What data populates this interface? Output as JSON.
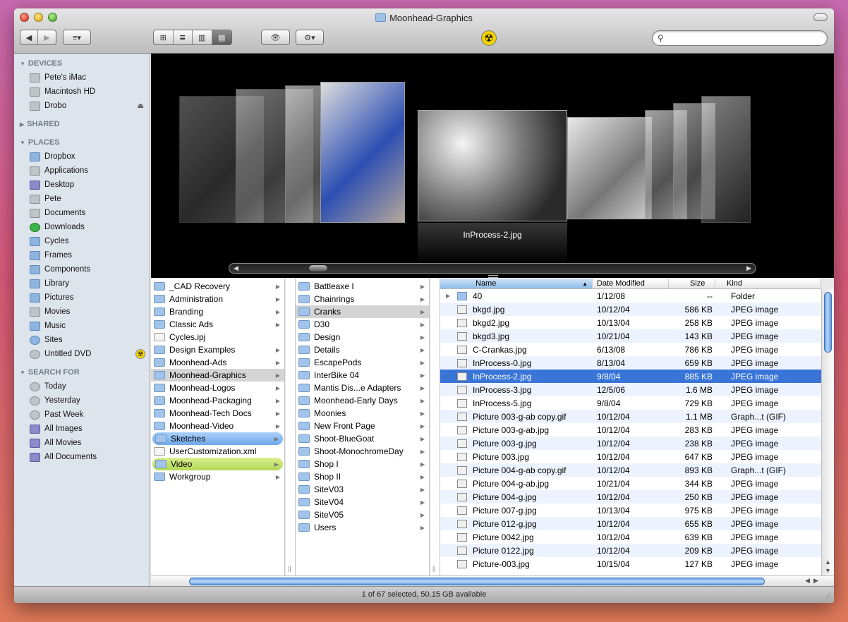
{
  "window": {
    "title": "Moonhead-Graphics"
  },
  "toolbar": {
    "back_icon": "◀",
    "forward_icon": "▶",
    "arrange_icon": "≡▾",
    "view_icons": [
      "⊞",
      "≣",
      "▥",
      "▤"
    ],
    "quicklook_icon": "👁",
    "action_icon": "⚙▾",
    "badge_icon": "☢",
    "search_placeholder": ""
  },
  "sidebar": {
    "sections": [
      {
        "title": "DEVICES",
        "items": [
          {
            "label": "Pete's iMac",
            "icon": "imac-icon"
          },
          {
            "label": "Macintosh HD",
            "icon": "disk-icon"
          },
          {
            "label": "Drobo",
            "icon": "drobo-icon",
            "eject": "⏏"
          }
        ]
      },
      {
        "title": "SHARED",
        "collapsed": true,
        "items": []
      },
      {
        "title": "PLACES",
        "items": [
          {
            "label": "Dropbox",
            "icon": "dropbox-icon"
          },
          {
            "label": "Applications",
            "icon": "applications-icon"
          },
          {
            "label": "Desktop",
            "icon": "desktop-icon"
          },
          {
            "label": "Pete",
            "icon": "home-icon"
          },
          {
            "label": "Documents",
            "icon": "documents-icon"
          },
          {
            "label": "Downloads",
            "icon": "downloads-icon"
          },
          {
            "label": "Cycles",
            "icon": "folder-icon"
          },
          {
            "label": "Frames",
            "icon": "folder-icon"
          },
          {
            "label": "Components",
            "icon": "folder-icon"
          },
          {
            "label": "Library",
            "icon": "folder-icon"
          },
          {
            "label": "Pictures",
            "icon": "pictures-icon"
          },
          {
            "label": "Movies",
            "icon": "movies-icon"
          },
          {
            "label": "Music",
            "icon": "music-icon"
          },
          {
            "label": "Sites",
            "icon": "sites-icon"
          },
          {
            "label": "Untitled DVD",
            "icon": "dvd-icon",
            "badge": "☢"
          }
        ]
      },
      {
        "title": "SEARCH FOR",
        "items": [
          {
            "label": "Today",
            "icon": "clock-icon"
          },
          {
            "label": "Yesterday",
            "icon": "clock-icon"
          },
          {
            "label": "Past Week",
            "icon": "clock-icon"
          },
          {
            "label": "All Images",
            "icon": "smart-folder-icon"
          },
          {
            "label": "All Movies",
            "icon": "smart-folder-icon"
          },
          {
            "label": "All Documents",
            "icon": "smart-folder-icon"
          }
        ]
      }
    ]
  },
  "coverflow": {
    "caption": "InProcess-2.jpg"
  },
  "column1": [
    {
      "label": "_CAD Recovery",
      "arrow": "▶"
    },
    {
      "label": "Administration",
      "arrow": "▶"
    },
    {
      "label": "Branding",
      "arrow": "▶"
    },
    {
      "label": "Classic Ads",
      "arrow": "▶"
    },
    {
      "label": "Cycles.ipj",
      "doc": true
    },
    {
      "label": "Design Examples",
      "arrow": "▶"
    },
    {
      "label": "Moonhead-Ads",
      "arrow": "▶"
    },
    {
      "label": "Moonhead-Graphics",
      "arrow": "▶",
      "state": "sel-gray"
    },
    {
      "label": "Moonhead-Logos",
      "arrow": "▶"
    },
    {
      "label": "Moonhead-Packaging",
      "arrow": "▶"
    },
    {
      "label": "Moonhead-Tech Docs",
      "arrow": "▶"
    },
    {
      "label": "Moonhead-Video",
      "arrow": "▶"
    },
    {
      "label": "Sketches",
      "arrow": "▶",
      "state": "tag-blue"
    },
    {
      "label": "UserCustomization.xml",
      "doc": true
    },
    {
      "label": "Video",
      "arrow": "▶",
      "state": "tag-green"
    },
    {
      "label": "Workgroup",
      "arrow": "▶"
    }
  ],
  "column2": [
    {
      "label": "Battleaxe I",
      "arrow": "▶"
    },
    {
      "label": "Chainrings",
      "arrow": "▶"
    },
    {
      "label": "Cranks",
      "arrow": "▶",
      "state": "sel-gray"
    },
    {
      "label": "D30",
      "arrow": "▶"
    },
    {
      "label": "Design",
      "arrow": "▶"
    },
    {
      "label": "Details",
      "arrow": "▶"
    },
    {
      "label": "EscapePods",
      "arrow": "▶"
    },
    {
      "label": "InterBike 04",
      "arrow": "▶"
    },
    {
      "label": "Mantis Dis...e Adapters",
      "arrow": "▶"
    },
    {
      "label": "Moonhead-Early Days",
      "arrow": "▶"
    },
    {
      "label": "Moonies",
      "arrow": "▶"
    },
    {
      "label": "New Front Page",
      "arrow": "▶"
    },
    {
      "label": "Shoot-BlueGoat",
      "arrow": "▶"
    },
    {
      "label": "Shoot-MonochromeDay",
      "arrow": "▶"
    },
    {
      "label": "Shop I",
      "arrow": "▶"
    },
    {
      "label": "Shop II",
      "arrow": "▶"
    },
    {
      "label": "SiteV03",
      "arrow": "▶"
    },
    {
      "label": "SiteV04",
      "arrow": "▶"
    },
    {
      "label": "SiteV05",
      "arrow": "▶"
    },
    {
      "label": "Users",
      "arrow": "▶"
    }
  ],
  "file_list": {
    "headers": {
      "name": "Name",
      "date": "Date Modified",
      "size": "Size",
      "kind": "Kind",
      "sort_icon": "▲"
    },
    "rows": [
      {
        "name": "40",
        "date": "1/12/08",
        "size": "--",
        "kind": "Folder",
        "folder": true,
        "disc": "▶"
      },
      {
        "name": "bkgd.jpg",
        "date": "10/12/04",
        "size": "586 KB",
        "kind": "JPEG image"
      },
      {
        "name": "bkgd2.jpg",
        "date": "10/13/04",
        "size": "258 KB",
        "kind": "JPEG image"
      },
      {
        "name": "bkgd3.jpg",
        "date": "10/21/04",
        "size": "143 KB",
        "kind": "JPEG image"
      },
      {
        "name": "C-Crankas.jpg",
        "date": "6/13/08",
        "size": "786 KB",
        "kind": "JPEG image"
      },
      {
        "name": "InProcess-0.jpg",
        "date": "8/13/04",
        "size": "659 KB",
        "kind": "JPEG image"
      },
      {
        "name": "InProcess-2.jpg",
        "date": "9/8/04",
        "size": "885 KB",
        "kind": "JPEG image",
        "selected": true
      },
      {
        "name": "InProcess-3.jpg",
        "date": "12/5/06",
        "size": "1.6 MB",
        "kind": "JPEG image"
      },
      {
        "name": "InProcess-5.jpg",
        "date": "9/8/04",
        "size": "729 KB",
        "kind": "JPEG image"
      },
      {
        "name": "Picture 003-g-ab copy.gif",
        "date": "10/12/04",
        "size": "1.1 MB",
        "kind": "Graph...t (GIF)"
      },
      {
        "name": "Picture 003-g-ab.jpg",
        "date": "10/12/04",
        "size": "283 KB",
        "kind": "JPEG image"
      },
      {
        "name": "Picture 003-g.jpg",
        "date": "10/12/04",
        "size": "238 KB",
        "kind": "JPEG image"
      },
      {
        "name": "Picture 003.jpg",
        "date": "10/12/04",
        "size": "647 KB",
        "kind": "JPEG image"
      },
      {
        "name": "Picture 004-g-ab copy.gif",
        "date": "10/12/04",
        "size": "893 KB",
        "kind": "Graph...t (GIF)"
      },
      {
        "name": "Picture 004-g-ab.jpg",
        "date": "10/21/04",
        "size": "344 KB",
        "kind": "JPEG image"
      },
      {
        "name": "Picture 004-g.jpg",
        "date": "10/12/04",
        "size": "250 KB",
        "kind": "JPEG image"
      },
      {
        "name": "Picture 007-g.jpg",
        "date": "10/13/04",
        "size": "975 KB",
        "kind": "JPEG image"
      },
      {
        "name": "Picture 012-g.jpg",
        "date": "10/12/04",
        "size": "655 KB",
        "kind": "JPEG image"
      },
      {
        "name": "Picture 0042.jpg",
        "date": "10/12/04",
        "size": "639 KB",
        "kind": "JPEG image"
      },
      {
        "name": "Picture 0122.jpg",
        "date": "10/12/04",
        "size": "209 KB",
        "kind": "JPEG image"
      },
      {
        "name": "Picture-003.jpg",
        "date": "10/15/04",
        "size": "127 KB",
        "kind": "JPEG image"
      }
    ]
  },
  "status": {
    "text": "1 of 67 selected, 50.15 GB available"
  },
  "colors": {
    "selection": "#3875d7",
    "tag_blue": "#70a8ec",
    "tag_green": "#b2d855",
    "sidebar_bg": "#dde4ec"
  }
}
